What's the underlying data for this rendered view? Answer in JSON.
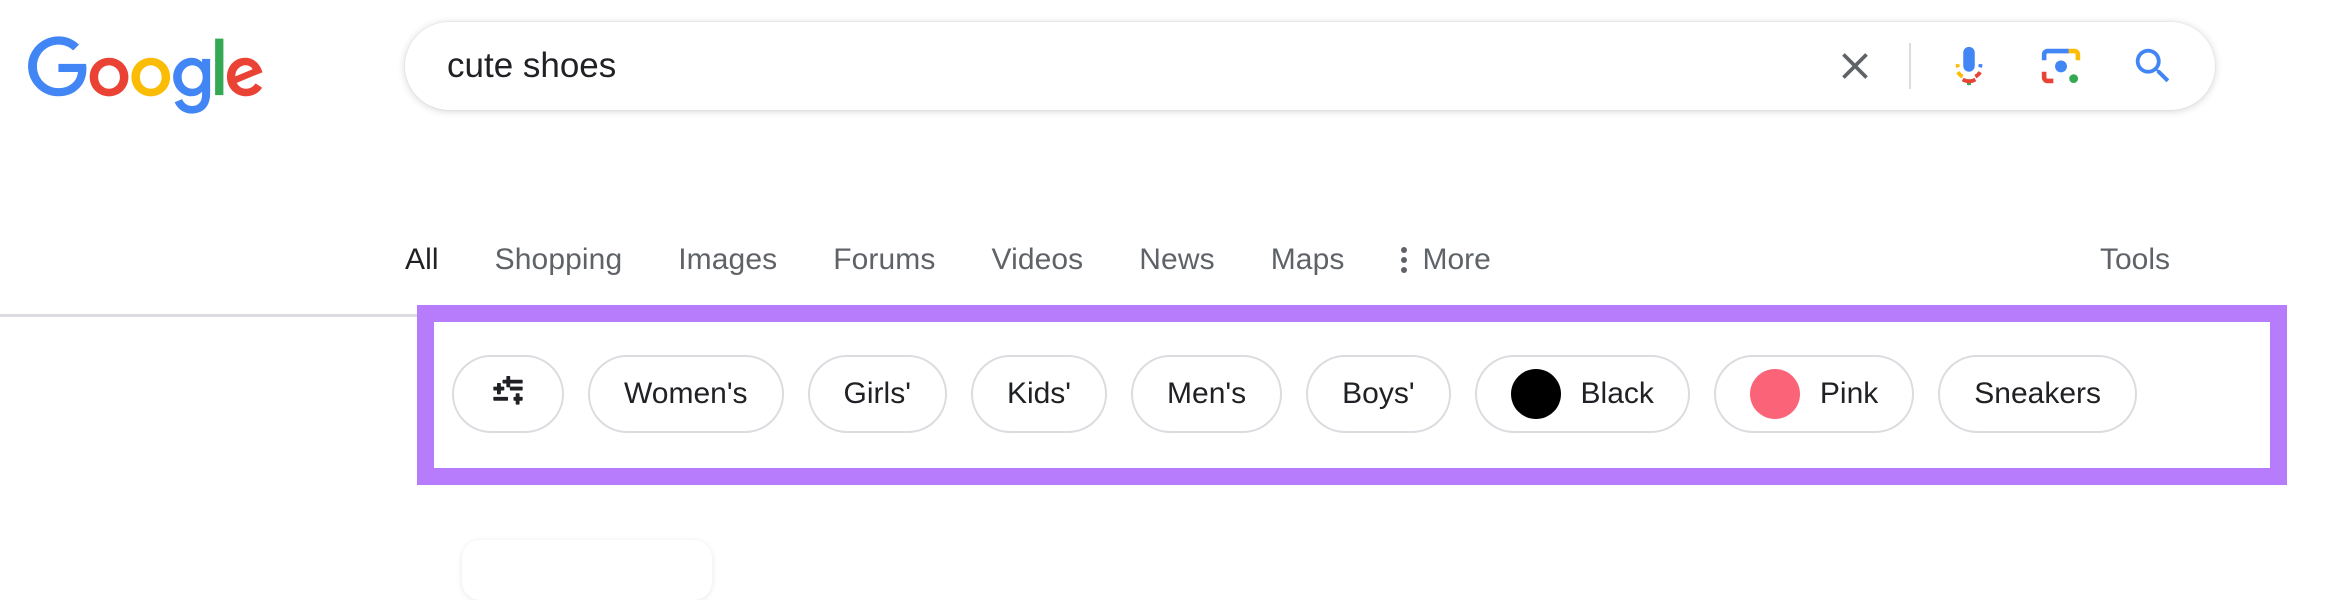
{
  "brand": {
    "logo_name": "google-logo",
    "letters": [
      {
        "char": "G",
        "color": "#4285F4"
      },
      {
        "char": "o",
        "color": "#EA4335"
      },
      {
        "char": "o",
        "color": "#FBBC05"
      },
      {
        "char": "g",
        "color": "#4285F4"
      },
      {
        "char": "l",
        "color": "#34A853"
      },
      {
        "char": "e",
        "color": "#EA4335"
      }
    ]
  },
  "search": {
    "query": "cute shoes",
    "placeholder": "Search",
    "clear_icon": "close-icon",
    "voice_icon": "microphone-icon",
    "lens_icon": "google-lens-icon",
    "search_icon": "search-icon"
  },
  "nav": {
    "tabs": [
      {
        "label": "All",
        "active": true
      },
      {
        "label": "Shopping",
        "active": false
      },
      {
        "label": "Images",
        "active": false
      },
      {
        "label": "Forums",
        "active": false
      },
      {
        "label": "Videos",
        "active": false
      },
      {
        "label": "News",
        "active": false
      },
      {
        "label": "Maps",
        "active": false
      }
    ],
    "more_label": "More",
    "more_icon": "vertical-dots-icon",
    "tools_label": "Tools"
  },
  "filters": {
    "tune_icon": "tune-filter-icon",
    "chips": [
      {
        "label": "Women's",
        "swatch": null
      },
      {
        "label": "Girls'",
        "swatch": null
      },
      {
        "label": "Kids'",
        "swatch": null
      },
      {
        "label": "Men's",
        "swatch": null
      },
      {
        "label": "Boys'",
        "swatch": null
      },
      {
        "label": "Black",
        "swatch": "#000000"
      },
      {
        "label": "Pink",
        "swatch": "#FB6378"
      },
      {
        "label": "Sneakers",
        "swatch": null
      }
    ]
  },
  "annotation": {
    "highlight_color": "#B77CFB",
    "target": "filter-chips-row"
  }
}
